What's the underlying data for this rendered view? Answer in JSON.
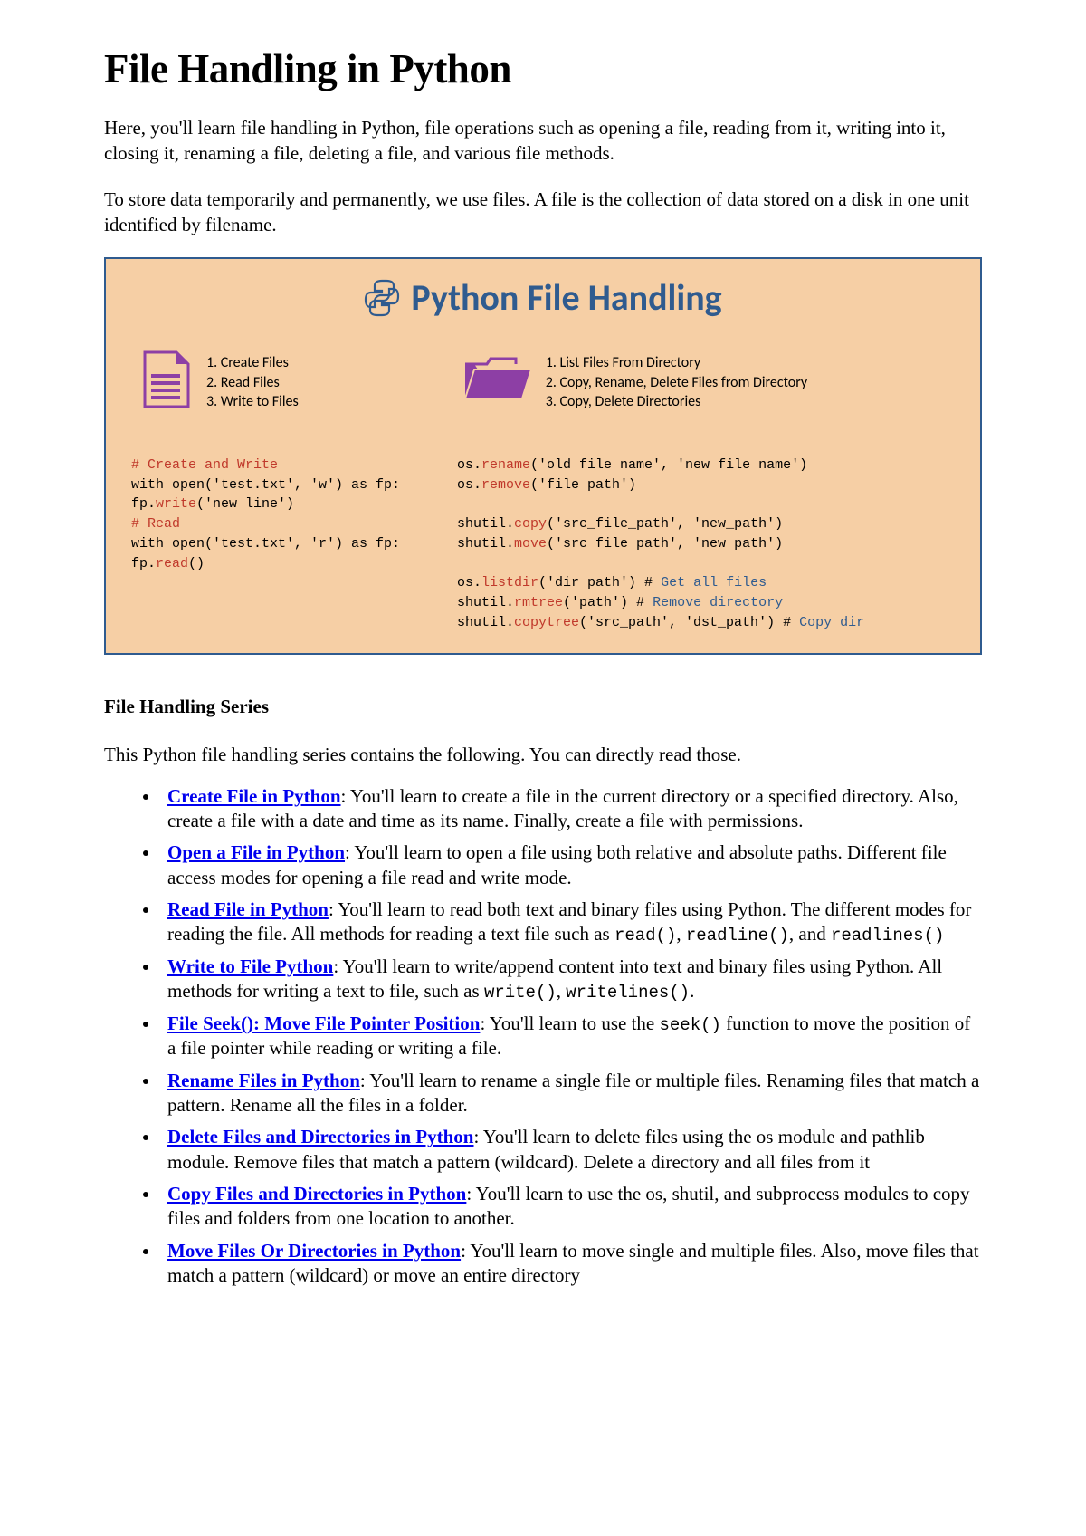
{
  "title": "File Handling in Python",
  "intro": [
    "Here, you'll learn file handling in Python, file operations such as opening a file, reading from it, writing into it, closing it, renaming a file, deleting a file, and various file methods.",
    "To store data temporarily and permanently, we use files. A file is the collection of data stored on a disk in one unit identified by filename."
  ],
  "diagram": {
    "heading": "Python File Handling",
    "left_list": [
      "1. Create Files",
      "2. Read Files",
      "3. Write to Files"
    ],
    "right_list": [
      "1. List Files From Directory",
      "2. Copy, Rename, Delete Files from Directory",
      "3. Copy, Delete Directories"
    ],
    "code_left": [
      {
        "t": "# Create and Write",
        "c": "kw-comment"
      },
      {
        "t": "with open('test.txt', 'w') as fp:",
        "c": "plain"
      },
      {
        "t": "    fp.",
        "c": "plain",
        "tail": {
          "t": "write",
          "c": "kw-fn"
        },
        "after": "('new line')"
      },
      {
        "t": "# Read",
        "c": "kw-comment"
      },
      {
        "t": "with open('test.txt', 'r') as fp:",
        "c": "plain"
      },
      {
        "t": "    fp.",
        "c": "plain",
        "tail": {
          "t": "read",
          "c": "kw-fn"
        },
        "after": "()"
      }
    ],
    "code_right": [
      [
        {
          "t": "os.",
          "c": "plain"
        },
        {
          "t": "rename",
          "c": "kw-fn"
        },
        {
          "t": "('old file name', 'new file name')",
          "c": "plain"
        }
      ],
      [
        {
          "t": "os.",
          "c": "plain"
        },
        {
          "t": "remove",
          "c": "kw-fn"
        },
        {
          "t": "('file path')",
          "c": "plain"
        }
      ],
      [
        {
          "t": "",
          "c": "plain"
        }
      ],
      [
        {
          "t": "shutil.",
          "c": "plain"
        },
        {
          "t": "copy",
          "c": "kw-fn"
        },
        {
          "t": "('src_file_path', 'new_path')",
          "c": "plain"
        }
      ],
      [
        {
          "t": "shutil.",
          "c": "plain"
        },
        {
          "t": "move",
          "c": "kw-fn"
        },
        {
          "t": "('src file path', 'new path')",
          "c": "plain"
        }
      ],
      [
        {
          "t": "",
          "c": "plain"
        }
      ],
      [
        {
          "t": "os.",
          "c": "plain"
        },
        {
          "t": "listdir",
          "c": "kw-fn"
        },
        {
          "t": "('dir path') # ",
          "c": "plain"
        },
        {
          "t": "Get all files",
          "c": "kw-blue"
        }
      ],
      [
        {
          "t": "shutil.",
          "c": "plain"
        },
        {
          "t": "rmtree",
          "c": "kw-fn"
        },
        {
          "t": "('path')  # ",
          "c": "plain"
        },
        {
          "t": "Remove directory",
          "c": "kw-blue"
        }
      ],
      [
        {
          "t": "shutil.",
          "c": "plain"
        },
        {
          "t": "copytree",
          "c": "kw-fn"
        },
        {
          "t": "('src_path', 'dst_path') # ",
          "c": "plain"
        },
        {
          "t": "Copy dir",
          "c": "kw-blue"
        }
      ]
    ]
  },
  "series_heading": "File Handling Series",
  "series_intro": "This Python file handling series contains the following. You can directly read those.",
  "series": [
    {
      "link": "Create File in Python",
      "text": ": You'll learn to create a file in the current directory or a specified directory. Also, create a file with a date and time as its name. Finally, create a file with permissions."
    },
    {
      "link": "Open a File in Python",
      "text": ": You'll learn to open a file using both relative and absolute paths. Different file access modes for opening a file read and write mode."
    },
    {
      "link": "Read File in Python",
      "text": ": You'll learn to read both text and binary files using Python. The different modes for reading the file. All methods for reading a text file such as ",
      "codes": [
        "read()",
        "readline()",
        "readlines()"
      ],
      "code_join": ", ",
      "code_prefix_and": ", and "
    },
    {
      "link": "Write to File Python",
      "text": ": You'll learn to write/append content into text and binary files using Python. All methods for writing a text to file, such as ",
      "codes": [
        "write()",
        "writelines()"
      ],
      "code_join": ", ",
      "code_suffix": "."
    },
    {
      "link": "File Seek(): Move File Pointer Position",
      "text": ": You'll learn to use the ",
      "codes": [
        "seek()"
      ],
      "code_suffix": " function to move the position of a file pointer while reading or writing a file."
    },
    {
      "link": "Rename Files in Python",
      "text": ": You'll learn to rename a single file or multiple files. Renaming files that match a pattern. Rename all the files in a folder."
    },
    {
      "link": "Delete Files and Directories in Python",
      "text": ": You'll learn to delete files using the os module and pathlib module. Remove files that match a pattern (wildcard). Delete a directory and all files from it"
    },
    {
      "link": "Copy Files and Directories in Python",
      "text": ": You'll learn to use the os, shutil, and subprocess modules to copy files and folders from one location to another."
    },
    {
      "link": "Move Files Or Directories in Python",
      "text": ": You'll learn to move single and multiple files. Also, move files that match a pattern (wildcard) or move an entire directory"
    }
  ]
}
